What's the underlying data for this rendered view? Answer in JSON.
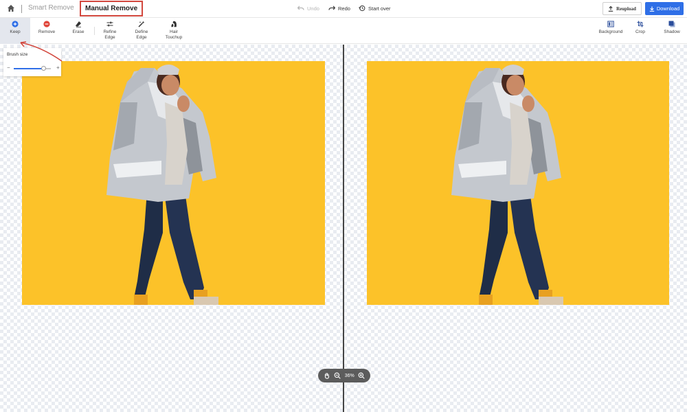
{
  "topbar": {
    "home_icon": "home-icon",
    "smart_remove_label": "Smart Remove",
    "manual_remove_label": "Manual Remove",
    "undo_label": "Undo",
    "redo_label": "Redo",
    "start_over_label": "Start over",
    "reupload_label": "Reupload",
    "download_label": "Download"
  },
  "toolbar": {
    "tools": [
      {
        "label": "Keep",
        "icon": "plus-circle-icon"
      },
      {
        "label": "Remove",
        "icon": "minus-circle-icon"
      },
      {
        "label": "Erase",
        "icon": "eraser-icon"
      },
      {
        "label_line1": "Refine",
        "label_line2": "Edge",
        "icon": "sliders-icon"
      },
      {
        "label_line1": "Define",
        "label_line2": "Edge",
        "icon": "magic-brush-icon"
      },
      {
        "label_line1": "Hair",
        "label_line2": "Touchup",
        "icon": "hair-icon"
      }
    ],
    "right_tools": [
      {
        "label": "Background",
        "icon": "background-icon"
      },
      {
        "label": "Crop",
        "icon": "crop-icon"
      },
      {
        "label": "Shadow",
        "icon": "shadow-icon"
      }
    ]
  },
  "brush": {
    "title": "Brush size",
    "minus": "−",
    "plus": "+",
    "level": 0.8
  },
  "zoom": {
    "level_label": "36%"
  },
  "colors": {
    "accent": "#2f6fe7",
    "highlight_box": "#d2473d",
    "photo_background": "#fcc229"
  }
}
